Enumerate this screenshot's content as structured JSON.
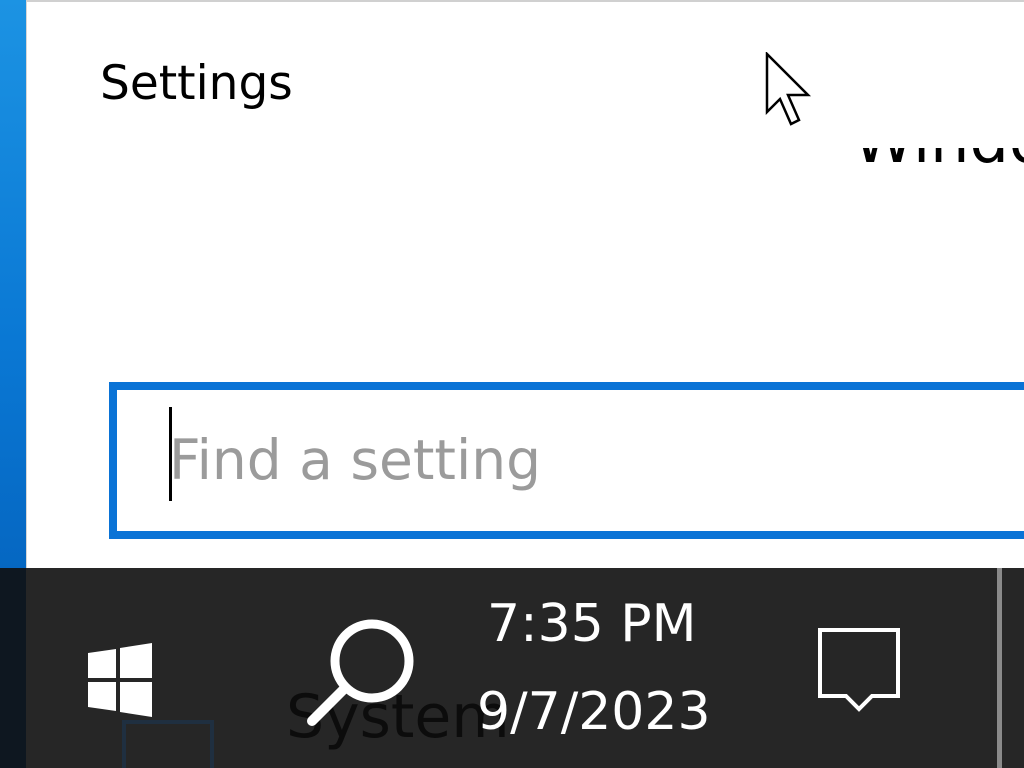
{
  "window": {
    "title": "Settings",
    "partial_header": "Windo"
  },
  "search": {
    "placeholder": "Find a setting",
    "value": ""
  },
  "taskbar": {
    "clock": {
      "time": "7:35 PM",
      "date": "9/7/2023"
    },
    "underlay_text": "System"
  },
  "icons": {
    "start": "windows-logo-icon",
    "search": "magnifier-icon",
    "action_center": "speech-bubble-icon",
    "pointer": "mouse-pointer-icon"
  },
  "colors": {
    "accent": "#0a73d6",
    "taskbar": "#262626",
    "desktop": "#1c93e3",
    "placeholder": "#9b9b9b"
  }
}
